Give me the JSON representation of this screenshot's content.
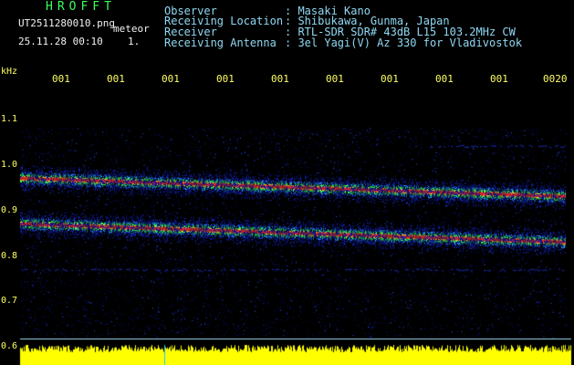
{
  "header": {
    "logo": "HROFFT",
    "filename": "UT2511280010.png",
    "meteor_label": "meteor",
    "timestamp": "25.11.28 00:10",
    "page_index": "1.",
    "info_rows": [
      {
        "key": "Observer",
        "value": ": Masaki Kano"
      },
      {
        "key": "Receiving Location",
        "value": ": Shibukawa, Gunma, Japan"
      },
      {
        "key": "Receiver",
        "value": ": RTL-SDR SDR# 43dB L15 103.2MHz CW"
      },
      {
        "key": "Receiving Antenna",
        "value": ": 3el Yagi(V) Az 330 for Vladivostok"
      }
    ]
  },
  "chart_data": {
    "type": "heatmap",
    "ylabel": "kHz",
    "ylim": [
      0.6,
      1.2
    ],
    "y_ticks": [
      "1.1",
      "1.0",
      "0.9",
      "0.8",
      "0.7",
      "0.6"
    ],
    "x_ticks": [
      "001",
      "001",
      "001",
      "001",
      "001",
      "001",
      "001",
      "001",
      "001",
      "0020"
    ],
    "bands": [
      {
        "freq_start_khz": 0.97,
        "freq_end_khz": 0.93
      },
      {
        "freq_start_khz": 0.87,
        "freq_end_khz": 0.83
      }
    ],
    "colors": {
      "background": "#000000",
      "noise": "#1a2ad6",
      "signal_core": "#ff2a1a",
      "signal_mid": "#33ff55",
      "amplitude_strip": "#ffff00",
      "tick_labels": "#ffff66",
      "header_text": "#8fd8f2"
    }
  }
}
